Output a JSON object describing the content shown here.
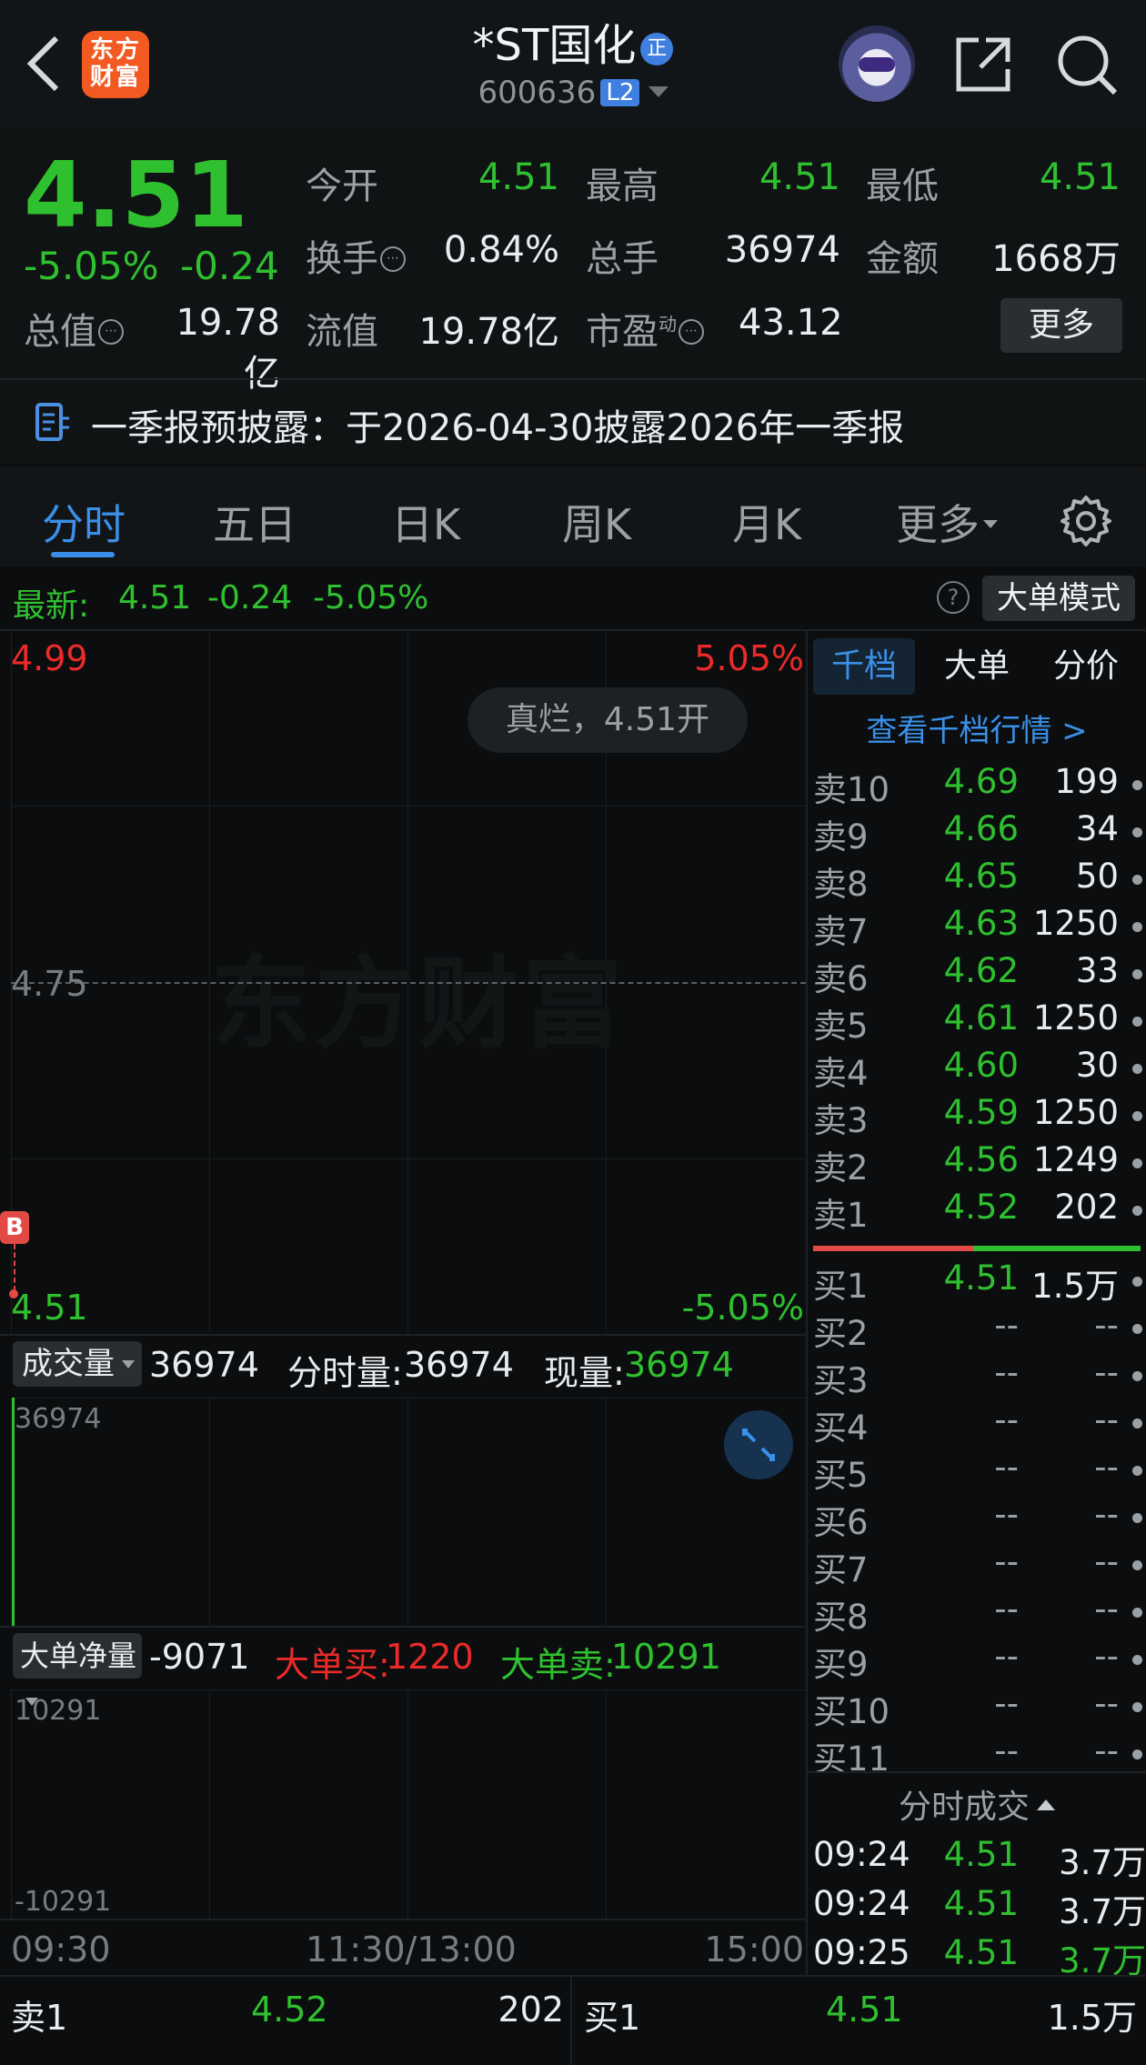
{
  "header": {
    "app_logo_text": "东方财富",
    "title": "*ST国化",
    "title_badge": "正",
    "code": "600636",
    "level_badge": "L2"
  },
  "quote": {
    "price": "4.51",
    "change_pct": "-5.05%",
    "change": "-0.24",
    "open_label": "今开",
    "open": "4.51",
    "high_label": "最高",
    "high": "4.51",
    "low_label": "最低",
    "low": "4.51",
    "turnover_label": "换手",
    "turnover": "0.84%",
    "volume_label": "总手",
    "volume": "36974",
    "amount_label": "金额",
    "amount": "1668万",
    "mktcap_label": "总值",
    "mktcap": "19.78亿",
    "float_label": "流值",
    "float": "19.78亿",
    "pe_label": "市盈",
    "pe_sup": "动",
    "pe": "43.12",
    "more_button": "更多"
  },
  "notice": {
    "text": "一季报预披露：于2026-04-30披露2026年一季报"
  },
  "tabs": [
    "分时",
    "五日",
    "日K",
    "周K",
    "月K",
    "更多"
  ],
  "chart_header": {
    "latest_label": "最新:",
    "latest": "4.51",
    "change": "-0.24",
    "change_pct": "-5.05%",
    "help": "?",
    "mode_button": "大单模式"
  },
  "chart": {
    "price_top": "4.99",
    "pct_top": "5.05%",
    "price_mid": "4.75",
    "price_bottom": "4.51",
    "pct_bottom": "-5.05%",
    "toast": "真烂，4.51开",
    "watermark": "东方财富",
    "marker": "B"
  },
  "volume": {
    "selector": "成交量",
    "value": "36974",
    "period_label": "分时量:",
    "period_value": "36974",
    "current_label": "现量:",
    "current_value": "36974",
    "axis_max": "36974"
  },
  "bigorder": {
    "selector": "大单净量",
    "net": "-9071",
    "buy_label": "大单买:",
    "buy": "1220",
    "sell_label": "大单卖:",
    "sell": "10291",
    "axis_max": "10291",
    "axis_min": "-10291"
  },
  "time_axis": [
    "09:30",
    "11:30/13:00",
    "15:00"
  ],
  "orderbook": {
    "tabs": [
      "千档",
      "大单",
      "分价"
    ],
    "link": "查看千档行情 >",
    "sells": [
      {
        "name": "卖10",
        "price": "4.69",
        "vol": "199"
      },
      {
        "name": "卖9",
        "price": "4.66",
        "vol": "34"
      },
      {
        "name": "卖8",
        "price": "4.65",
        "vol": "50"
      },
      {
        "name": "卖7",
        "price": "4.63",
        "vol": "1250"
      },
      {
        "name": "卖6",
        "price": "4.62",
        "vol": "33"
      },
      {
        "name": "卖5",
        "price": "4.61",
        "vol": "1250"
      },
      {
        "name": "卖4",
        "price": "4.60",
        "vol": "30"
      },
      {
        "name": "卖3",
        "price": "4.59",
        "vol": "1250"
      },
      {
        "name": "卖2",
        "price": "4.56",
        "vol": "1249"
      },
      {
        "name": "卖1",
        "price": "4.52",
        "vol": "202"
      }
    ],
    "buys": [
      {
        "name": "买1",
        "price": "4.51",
        "vol": "1.5万"
      },
      {
        "name": "买2",
        "price": "--",
        "vol": "--"
      },
      {
        "name": "买3",
        "price": "--",
        "vol": "--"
      },
      {
        "name": "买4",
        "price": "--",
        "vol": "--"
      },
      {
        "name": "买5",
        "price": "--",
        "vol": "--"
      },
      {
        "name": "买6",
        "price": "--",
        "vol": "--"
      },
      {
        "name": "买7",
        "price": "--",
        "vol": "--"
      },
      {
        "name": "买8",
        "price": "--",
        "vol": "--"
      },
      {
        "name": "买9",
        "price": "--",
        "vol": "--"
      },
      {
        "name": "买10",
        "price": "--",
        "vol": "--"
      },
      {
        "name": "买11",
        "price": "--",
        "vol": "--"
      }
    ],
    "trades_title": "分时成交",
    "trades": [
      {
        "time": "09:24",
        "price": "4.51",
        "vol": "3.7万"
      },
      {
        "time": "09:24",
        "price": "4.51",
        "vol": "3.7万"
      },
      {
        "time": "09:25",
        "price": "4.51",
        "vol": "3.7万"
      }
    ]
  },
  "bottom_bar": {
    "sell_label": "卖1",
    "sell_price": "4.52",
    "sell_vol": "202",
    "buy_label": "买1",
    "buy_price": "4.51",
    "buy_vol": "1.5万"
  },
  "colors": {
    "up": "#ec2a2a",
    "down": "#2fc02f",
    "accent": "#3a8fe8",
    "background": "#0b0d0e"
  }
}
